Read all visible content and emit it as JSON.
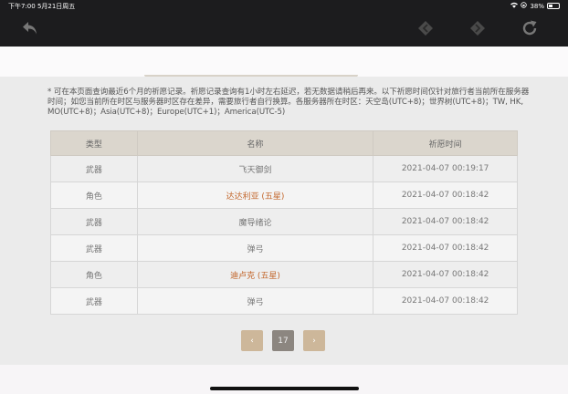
{
  "statusbar": {
    "time": "下午7:00   5月21日周五",
    "battery": "38%"
  },
  "toolbar": {
    "back_icon": "undo-arrow-icon",
    "nav_prev_icon": "diamond-left-icon",
    "nav_next_icon": "diamond-right-icon",
    "refresh_icon": "refresh-icon"
  },
  "notice": "* 可在本页面查询最近6个月的祈愿记录。祈愿记录查询有1小时左右延迟，若无数据请稍后再来。以下祈愿时间仅针对旅行者当前所在服务器时间；如您当前所在时区与服务器时区存在差异，需要旅行者自行换算。各服务器所在时区：天空岛(UTC+8)；世界树(UTC+8)；TW, HK, MO(UTC+8)；Asia(UTC+8)；Europe(UTC+1)；America(UTC-5)",
  "table": {
    "headers": [
      "类型",
      "名称",
      "祈愿时间"
    ],
    "rows": [
      {
        "type": "武器",
        "name": "飞天御剑",
        "time": "2021-04-07 00:19:17",
        "five_star": false
      },
      {
        "type": "角色",
        "name": "达达利亚 (五星)",
        "time": "2021-04-07 00:18:42",
        "five_star": true
      },
      {
        "type": "武器",
        "name": "魔导绪论",
        "time": "2021-04-07 00:18:42",
        "five_star": false
      },
      {
        "type": "武器",
        "name": "弹弓",
        "time": "2021-04-07 00:18:42",
        "five_star": false
      },
      {
        "type": "角色",
        "name": "迪卢克 (五星)",
        "time": "2021-04-07 00:18:42",
        "five_star": true
      },
      {
        "type": "武器",
        "name": "弹弓",
        "time": "2021-04-07 00:18:42",
        "five_star": false
      }
    ]
  },
  "pager": {
    "prev": "‹",
    "page": "17",
    "next": "›"
  },
  "colors": {
    "five_star": "#c2652a",
    "header_bg": "#dbd6cd",
    "pager_arrow": "#cdb79a",
    "pager_current": "#8c8680"
  }
}
